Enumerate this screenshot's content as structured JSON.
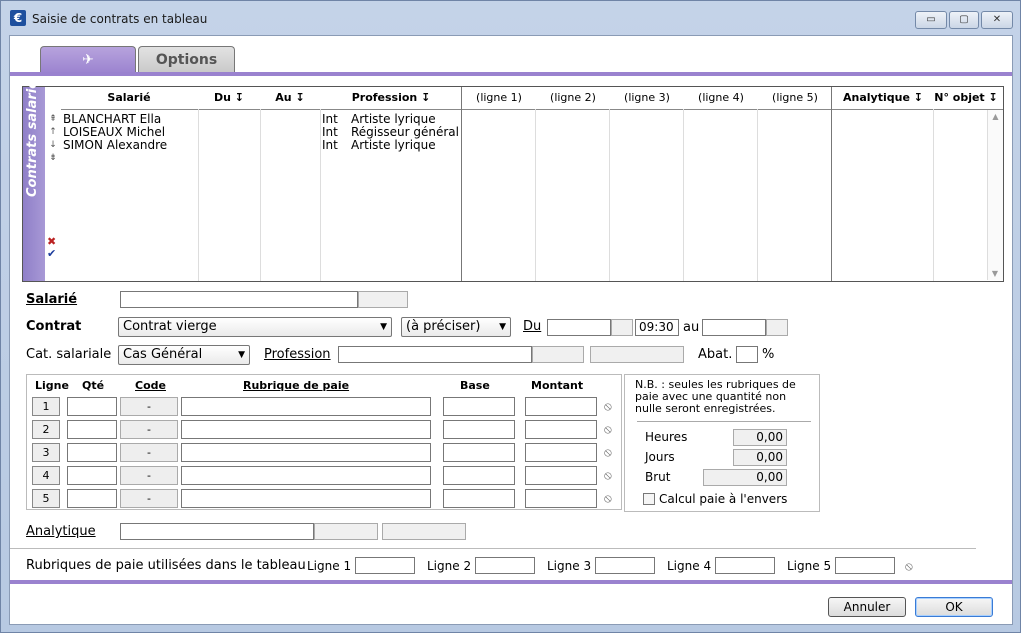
{
  "window": {
    "title": "Saisie de contrats en tableau",
    "icon": "€",
    "minimize": "▭",
    "maximize": "▢",
    "close": "✕"
  },
  "tabs": {
    "tab1_icon": "✈",
    "tab2_label": "Options"
  },
  "grid": {
    "side_label": "Contrats salarié",
    "headers": {
      "salarie": "Salarié",
      "du": "Du ↧",
      "au": "Au ↧",
      "profession": "Profession ↧",
      "ligne1": "(ligne 1)",
      "ligne2": "(ligne 2)",
      "ligne3": "(ligne 3)",
      "ligne4": "(ligne 4)",
      "ligne5": "(ligne 5)",
      "analytique": "Analytique ↧",
      "objet": "N° objet ↧"
    },
    "rows": [
      {
        "salarie": "BLANCHART Ella",
        "type": "Int",
        "profession": "Artiste lyrique"
      },
      {
        "salarie": "LOISEAUX Michel",
        "type": "Int",
        "profession": "Régisseur général t"
      },
      {
        "salarie": "SIMON Alexandre",
        "type": "Int",
        "profession": "Artiste lyrique"
      }
    ],
    "arrows": [
      "⇞",
      "↑",
      "↓",
      "⇟"
    ],
    "delete_icon": "✖",
    "validate_icon": "✔"
  },
  "form": {
    "salarie_label": "Salarié",
    "contrat_label": "Contrat",
    "contrat_value": "Contrat vierge",
    "contrat_detail": "(à préciser)",
    "du_label": "Du",
    "heure_value": "09:30",
    "au_label": "au",
    "cat_label": "Cat. salariale",
    "cat_value": "Cas Général",
    "profession_label": "Profession",
    "abat_label": "Abat.",
    "percent": "%"
  },
  "rubriques": {
    "headers": {
      "ligne": "Ligne",
      "qte": "Qté",
      "code": "Code",
      "rubrique": "Rubrique de paie",
      "base": "Base",
      "montant": "Montant"
    },
    "lines": [
      "1",
      "2",
      "3",
      "4",
      "5"
    ],
    "dash": "-",
    "no_icon": "⦸"
  },
  "nb": {
    "text": "N.B. : seules les rubriques de paie avec une quantité non nulle seront enregistrées.",
    "heures_label": "Heures",
    "heures_value": "0,00",
    "jours_label": "Jours",
    "jours_value": "0,00",
    "brut_label": "Brut",
    "brut_value": "0,00",
    "calcul_label": "Calcul paie à l'envers"
  },
  "analytique_label": "Analytique",
  "bottom": {
    "label": "Rubriques de paie utilisées dans le tableau",
    "l1": "Ligne 1",
    "l2": "Ligne 2",
    "l3": "Ligne 3",
    "l4": "Ligne 4",
    "l5": "Ligne 5"
  },
  "buttons": {
    "annuler": "Annuler",
    "ok": "OK"
  }
}
